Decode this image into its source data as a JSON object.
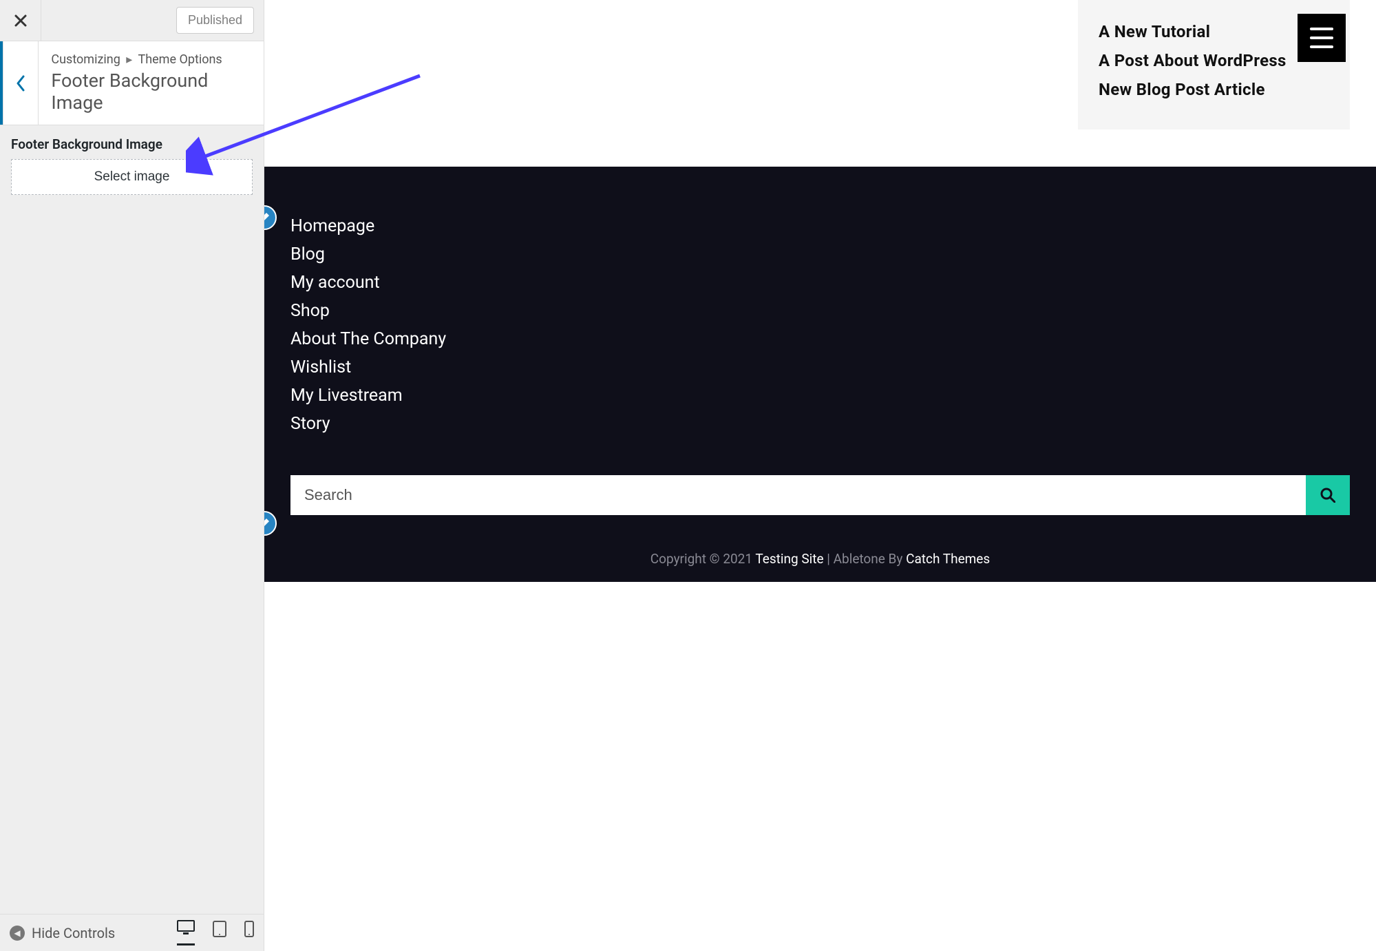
{
  "sidebar": {
    "publish_label": "Published",
    "breadcrumb_root": "Customizing",
    "breadcrumb_leaf": "Theme Options",
    "panel_title": "Footer Background Image",
    "control_label": "Footer Background Image",
    "select_image_label": "Select image",
    "hide_controls_label": "Hide Controls"
  },
  "preview": {
    "recent_posts": [
      "A New Tutorial",
      "A Post About WordPress",
      "New Blog Post Article"
    ],
    "footer_nav": [
      "Homepage",
      "Blog",
      "My account",
      "Shop",
      "About The Company",
      "Wishlist",
      "My Livestream",
      "Story"
    ],
    "search_placeholder": "Search",
    "copyright_prefix": "Copyright © 2021 ",
    "copyright_site": "Testing Site",
    "copyright_mid": " | Abletone By ",
    "copyright_theme": "Catch Themes"
  }
}
